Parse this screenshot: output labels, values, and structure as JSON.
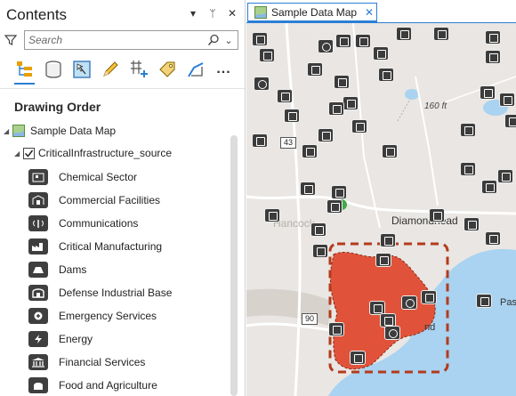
{
  "contents": {
    "title": "Contents",
    "controls": {
      "menu": "▾",
      "pin": "ᛘ",
      "close": "✕"
    },
    "search": {
      "placeholder": "Search",
      "dropdown": "⌄"
    },
    "toolbar": [
      "list-by-drawing-order-icon",
      "list-by-source-icon",
      "list-by-selection-icon",
      "list-by-editing-icon",
      "list-by-snapping-icon",
      "list-by-labeling-icon",
      "list-by-perspective-imagery-icon"
    ],
    "toolbar_more": "...",
    "heading": "Drawing Order",
    "map_item": "Sample Data Map",
    "layer": "CriticalInfrastructure_source",
    "legend": [
      {
        "label": "Chemical Sector",
        "icon": "chemical-sector-icon"
      },
      {
        "label": "Commercial Facilities",
        "icon": "commercial-facilities-icon"
      },
      {
        "label": "Communications",
        "icon": "communications-icon"
      },
      {
        "label": "Critical Manufacturing",
        "icon": "critical-manufacturing-icon"
      },
      {
        "label": "Dams",
        "icon": "dams-icon"
      },
      {
        "label": "Defense Industrial Base",
        "icon": "defense-industrial-base-icon"
      },
      {
        "label": "Emergency Services",
        "icon": "emergency-services-icon"
      },
      {
        "label": "Energy",
        "icon": "energy-icon"
      },
      {
        "label": "Financial Services",
        "icon": "financial-services-icon"
      },
      {
        "label": "Food and Agriculture",
        "icon": "food-and-agriculture-icon"
      }
    ]
  },
  "map": {
    "tab_label": "Sample Data Map",
    "tab_close": "✕",
    "labels": {
      "elevation": "160 ft",
      "hwy_43": "43",
      "hwy_90": "90",
      "diamondhead": "Diamondhead",
      "hancock": "Hancock",
      "pas": "Pas",
      "bay_fragment": "nd"
    },
    "colors": {
      "water": "#a9d3f0",
      "land": "#e9e6e3",
      "selection_fill": "#e0533a",
      "selection_border": "#b43a1c",
      "accent": "#2b7ed6"
    }
  }
}
